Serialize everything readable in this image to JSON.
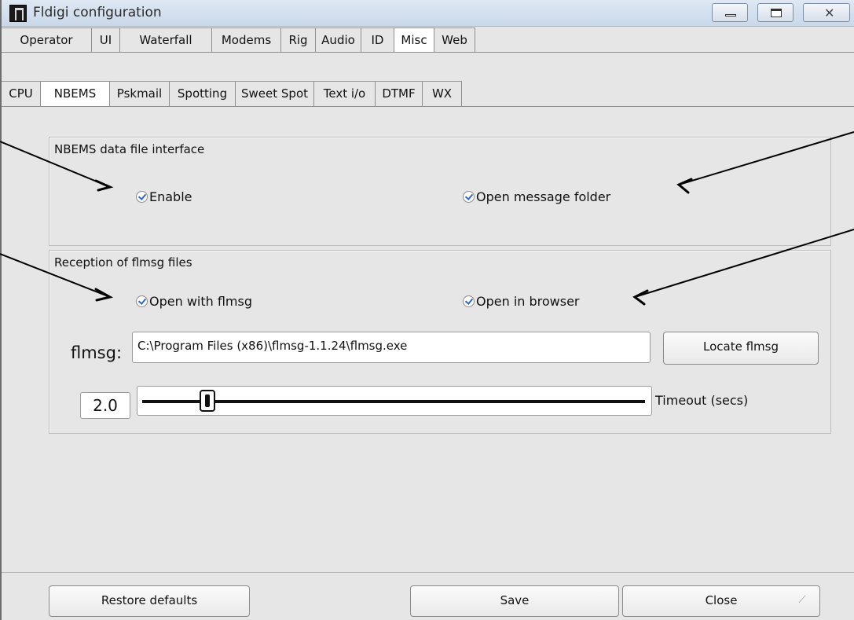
{
  "window": {
    "title": "Fldigi configuration",
    "close_glyph": "✕"
  },
  "tabs_main": [
    {
      "label": "Operator"
    },
    {
      "label": "UI"
    },
    {
      "label": "Waterfall"
    },
    {
      "label": "Modems"
    },
    {
      "label": "Rig"
    },
    {
      "label": "Audio"
    },
    {
      "label": "ID"
    },
    {
      "label": "Misc"
    },
    {
      "label": "Web"
    }
  ],
  "tabs_main_active": "Misc",
  "tabs_sub": [
    {
      "label": "CPU"
    },
    {
      "label": "NBEMS"
    },
    {
      "label": "Pskmail"
    },
    {
      "label": "Spotting"
    },
    {
      "label": "Sweet Spot"
    },
    {
      "label": "Text i/o"
    },
    {
      "label": "DTMF"
    },
    {
      "label": "WX"
    }
  ],
  "tabs_sub_active": "NBEMS",
  "group_data_file": {
    "label": "NBEMS data file interface",
    "enable": {
      "label": "Enable",
      "checked": true
    },
    "open_folder": {
      "label": "Open message folder",
      "checked": true
    }
  },
  "group_reception": {
    "label": "Reception of flmsg files",
    "open_flmsg": {
      "label": "Open with flmsg",
      "checked": true
    },
    "open_browser": {
      "label": "Open in browser",
      "checked": true
    },
    "flmsg_label": "flmsg:",
    "flmsg_path": "C:\\Program Files (x86)\\flmsg-1.1.24\\flmsg.exe",
    "locate_button": "Locate flmsg",
    "timeout_value": "2.0",
    "timeout_fraction": 0.13,
    "timeout_label": "Timeout (secs)"
  },
  "bottom": {
    "restore_button": "Restore defaults",
    "save_button": "Save",
    "close_button": "Close"
  },
  "colors": {
    "window_bg": "#e6e6e6",
    "title_bar": "#c9d8ea",
    "check_mark": "#2c68c9",
    "annotation_arrow": "#000000"
  }
}
